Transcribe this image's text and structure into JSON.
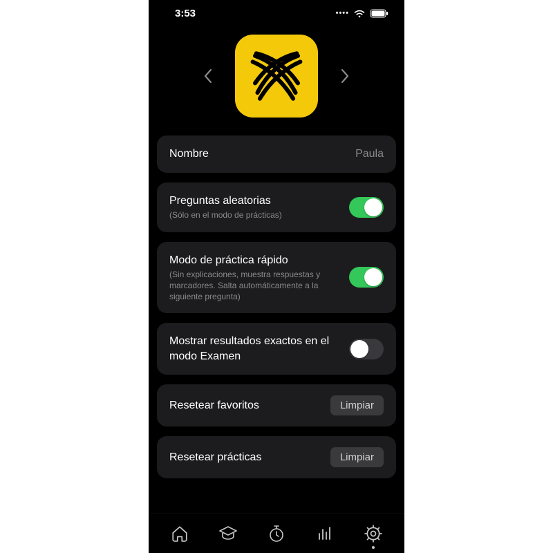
{
  "status": {
    "time": "3:53"
  },
  "settings": {
    "name_label": "Nombre",
    "name_value": "Paula",
    "random_q_label": "Preguntas aleatorias",
    "random_q_sub": "(Sólo en el modo de prácticas)",
    "fast_mode_label": "Modo de práctica rápido",
    "fast_mode_sub": "(Sin explicaciones, muestra respuestas y marcadores. Salta automáticamente a la siguiente pregunta)",
    "exact_results_label": "Mostrar resultados exactos en el modo Examen",
    "reset_fav_label": "Resetear favoritos",
    "reset_prac_label": "Resetear prácticas",
    "clear_button": "Limpiar"
  }
}
